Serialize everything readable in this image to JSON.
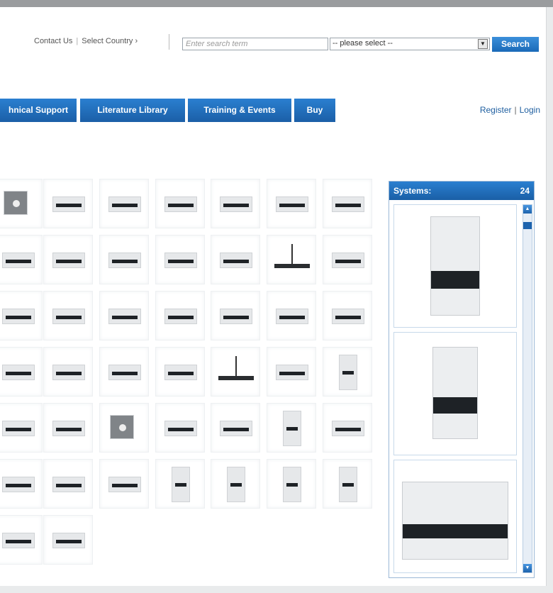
{
  "header": {
    "contact_us": "Contact Us",
    "separator": "|",
    "select_country": "Select Country ›",
    "search_placeholder": "Enter search term",
    "select_value": "-- please select --",
    "search_button": "Search"
  },
  "nav": {
    "tabs": [
      {
        "label": "hnical Support"
      },
      {
        "label": "Literature Library"
      },
      {
        "label": "Training & Events"
      },
      {
        "label": "Buy"
      }
    ],
    "register": "Register",
    "login": "Login"
  },
  "systems": {
    "title": "Systems:",
    "count": "24"
  },
  "colors": {
    "brand_blue": "#1b5fa7",
    "link_blue": "#1f5fa0"
  }
}
